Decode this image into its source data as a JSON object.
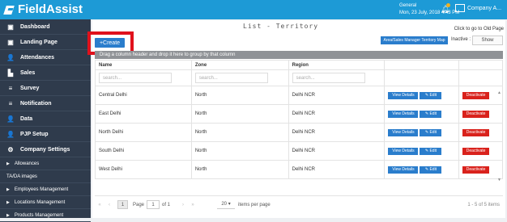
{
  "topbar": {
    "brand": "FieldAssist",
    "user_line1": "General",
    "user_line2": "Mon, 23 July, 2018 4:43 PM",
    "company": "Company A..."
  },
  "sidebar": {
    "items": [
      {
        "label": "Dashboard",
        "icon": "dashboard-icon",
        "glyph": "▣"
      },
      {
        "label": "Landing Page",
        "icon": "landing-page-icon",
        "glyph": "▣"
      },
      {
        "label": "Attendances",
        "icon": "user-icon",
        "glyph": "👤"
      },
      {
        "label": "Sales",
        "icon": "chart-icon",
        "glyph": "▙"
      },
      {
        "label": "Survey",
        "icon": "survey-icon",
        "glyph": "≡"
      },
      {
        "label": "Notification",
        "icon": "notification-icon",
        "glyph": "≡"
      },
      {
        "label": "Data",
        "icon": "data-icon",
        "glyph": "👤"
      },
      {
        "label": "PJP Setup",
        "icon": "pjp-icon",
        "glyph": "👤"
      },
      {
        "label": "Company Settings",
        "icon": "settings-icon",
        "glyph": "⚙"
      }
    ],
    "sub_items": [
      {
        "label": "Allowances",
        "arrow": true
      },
      {
        "label": "TA/DA images",
        "arrow": false
      },
      {
        "label": "Employees Management",
        "arrow": true
      },
      {
        "label": "Locations Management",
        "arrow": true
      },
      {
        "label": "Products Management",
        "arrow": true
      }
    ]
  },
  "main": {
    "title": "List - Territory",
    "old_page": "Click to go to Old Page",
    "create_label": "+Create",
    "map_button": "Area/Sales Manager Territory Map",
    "inactive_label": "Inactive :",
    "show_button": "Show",
    "group_hint": "Drag a column header and drop it here to group by that column",
    "columns": [
      "Name",
      "Zone",
      "Region",
      "",
      ""
    ],
    "filter_placeholder": "search...",
    "rows": [
      {
        "name": "Central Delhi",
        "zone": "North",
        "region": "Delhi NCR"
      },
      {
        "name": "East Delhi",
        "zone": "North",
        "region": "Delhi NCR"
      },
      {
        "name": "North Delhi",
        "zone": "North",
        "region": "Delhi NCR"
      },
      {
        "name": "South Delhi",
        "zone": "North",
        "region": "Delhi NCR"
      },
      {
        "name": "West Delhi",
        "zone": "North",
        "region": "Delhi NCR"
      }
    ],
    "actions": {
      "details": "View Details",
      "edit": "Edit",
      "deactivate": "Deactivate"
    }
  },
  "pager": {
    "current": "1",
    "page_label": "Page",
    "page_value": "1",
    "of_label": "of 1",
    "page_size": "20",
    "items_per_page": "items per page",
    "info": "1 - 5 of 5 items"
  }
}
